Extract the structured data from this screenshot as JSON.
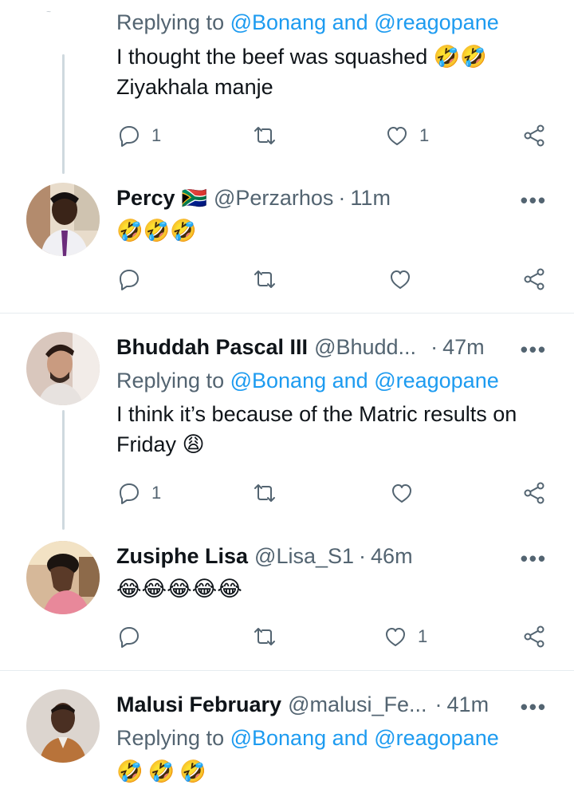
{
  "top_reply": {
    "replying_prefix": "Replying to",
    "mention1": "@Bonang",
    "and_word": "and",
    "mention2": "@reagopane",
    "line1": "I thought the beef was squashed 🤣🤣",
    "line2": "Ziyakhala manje",
    "reply_count": "1",
    "like_count": "1"
  },
  "percy": {
    "name": "Percy",
    "flag": "🇿🇦",
    "handle": "@Perzarhos",
    "time": "11m",
    "text": "🤣🤣🤣"
  },
  "bhuddah": {
    "name": "Bhuddah Pascal III",
    "handle": "@Bhudd...",
    "time": "47m",
    "replying_prefix": "Replying to",
    "mention1": "@Bonang",
    "and_word": "and",
    "mention2": "@reagopane",
    "line1": "I think it’s because of the Matric results on",
    "line2": "Friday 😩",
    "reply_count": "1"
  },
  "zusiphe": {
    "name": "Zusiphe Lisa",
    "handle": "@Lisa_S1",
    "time": "46m",
    "text": "😂😂😂😂😂",
    "like_count": "1"
  },
  "malusi": {
    "name": "Malusi February",
    "handle": "@malusi_Fe...",
    "time": "41m",
    "replying_prefix": "Replying to",
    "mention1": "@Bonang",
    "and_word": "and",
    "mention2": "@reagopane",
    "text": "🤣🤣🤣"
  },
  "ui": {
    "more_glyph": "•••",
    "dot": "·",
    "icons": [
      "reply-icon",
      "retweet-icon",
      "like-icon",
      "share-icon"
    ]
  },
  "colors": {
    "text": "#0f1419",
    "secondary": "#536471",
    "link": "#1d9bf0",
    "thread_line": "#cfd9de",
    "divider": "#e6ecf0"
  }
}
